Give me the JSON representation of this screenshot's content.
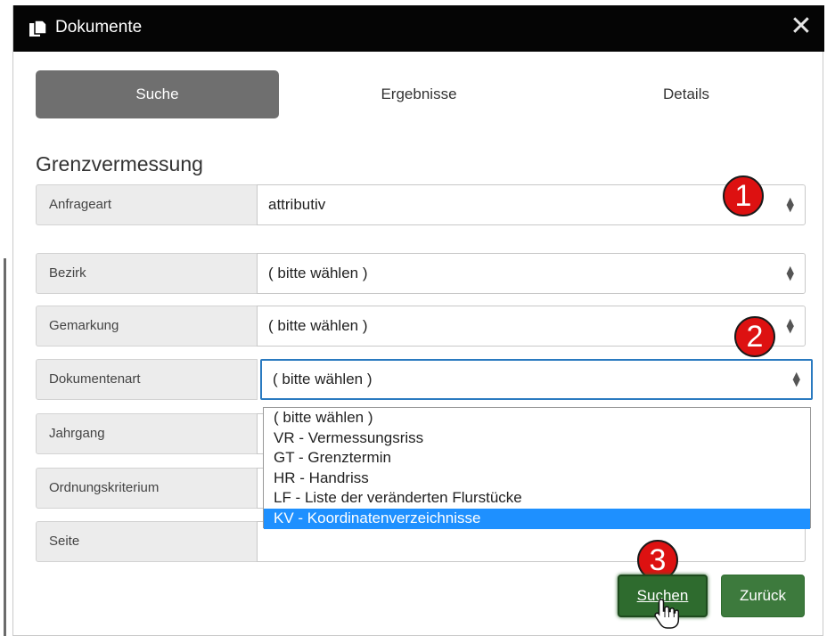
{
  "window": {
    "title": "Dokumente",
    "title_icon": "document-stack-icon",
    "close_symbol": "✕"
  },
  "tabs": [
    {
      "label": "Suche",
      "active": true
    },
    {
      "label": "Ergebnisse",
      "active": false
    },
    {
      "label": "Details",
      "active": false
    }
  ],
  "section_title": "Grenzvermessung",
  "fields": {
    "anfrageart": {
      "label": "Anfrageart",
      "value": "attributiv"
    },
    "bezirk": {
      "label": "Bezirk",
      "value": "( bitte wählen )"
    },
    "gemarkung": {
      "label": "Gemarkung",
      "value": "( bitte wählen )"
    },
    "dokumentenart": {
      "label": "Dokumentenart",
      "value": "( bitte wählen )"
    },
    "jahrgang": {
      "label": "Jahrgang"
    },
    "ordnungskriterium": {
      "label": "Ordnungskriterium"
    },
    "seite": {
      "label": "Seite",
      "value": ""
    }
  },
  "dropdown_options": [
    "( bitte wählen )",
    "VR - Vermessungsriss",
    "GT - Grenztermin",
    "HR - Handriss",
    "LF - Liste der veränderten Flurstücke",
    "KV - Koordinatenverzeichnisse"
  ],
  "highlighted_option": "KV - Koordinatenverzeichnisse",
  "badges": [
    "1",
    "2",
    "3"
  ],
  "buttons": {
    "search": "Suchen",
    "back": "Zurück"
  },
  "colors": {
    "titlebar": "#050505",
    "active_tab": "#6f6f6f",
    "highlight": "#1e90ff",
    "badge": "#dd1111",
    "button_green": "#3d7a3d"
  }
}
